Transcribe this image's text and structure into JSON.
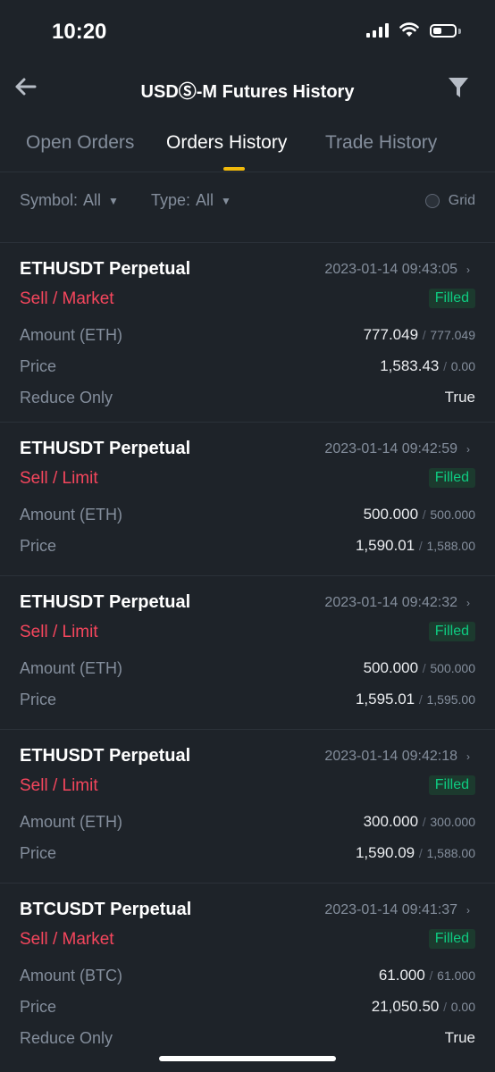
{
  "status_bar": {
    "time": "10:20"
  },
  "header": {
    "title": "USDⓈ-M Futures History"
  },
  "tabs": [
    {
      "label": "Open Orders",
      "active": false
    },
    {
      "label": "Orders History",
      "active": true
    },
    {
      "label": "Trade History",
      "active": false
    }
  ],
  "filters": {
    "symbol_label": "Symbol:",
    "symbol_value": "All",
    "type_label": "Type:",
    "type_value": "All",
    "grid_label": "Grid"
  },
  "colors": {
    "background": "#1e2329",
    "sell": "#f6465d",
    "filled": "#0ecb81",
    "accent": "#f0b90b"
  },
  "orders": [
    {
      "symbol": "ETHUSDT Perpetual",
      "timestamp": "2023-01-14 09:43:05",
      "side": "Sell / Market",
      "status": "Filled",
      "rows": [
        {
          "label": "Amount (ETH)",
          "value": "777.049",
          "sub": "777.049"
        },
        {
          "label": "Price",
          "value": "1,583.43",
          "sub": "0.00"
        },
        {
          "label": "Reduce Only",
          "value": "True",
          "sub": ""
        }
      ]
    },
    {
      "symbol": "ETHUSDT Perpetual",
      "timestamp": "2023-01-14 09:42:59",
      "side": "Sell / Limit",
      "status": "Filled",
      "rows": [
        {
          "label": "Amount (ETH)",
          "value": "500.000",
          "sub": "500.000"
        },
        {
          "label": "Price",
          "value": "1,590.01",
          "sub": "1,588.00"
        }
      ]
    },
    {
      "symbol": "ETHUSDT Perpetual",
      "timestamp": "2023-01-14 09:42:32",
      "side": "Sell / Limit",
      "status": "Filled",
      "rows": [
        {
          "label": "Amount (ETH)",
          "value": "500.000",
          "sub": "500.000"
        },
        {
          "label": "Price",
          "value": "1,595.01",
          "sub": "1,595.00"
        }
      ]
    },
    {
      "symbol": "ETHUSDT Perpetual",
      "timestamp": "2023-01-14 09:42:18",
      "side": "Sell / Limit",
      "status": "Filled",
      "rows": [
        {
          "label": "Amount (ETH)",
          "value": "300.000",
          "sub": "300.000"
        },
        {
          "label": "Price",
          "value": "1,590.09",
          "sub": "1,588.00"
        }
      ]
    },
    {
      "symbol": "BTCUSDT Perpetual",
      "timestamp": "2023-01-14 09:41:37",
      "side": "Sell / Market",
      "status": "Filled",
      "rows": [
        {
          "label": "Amount (BTC)",
          "value": "61.000",
          "sub": "61.000"
        },
        {
          "label": "Price",
          "value": "21,050.50",
          "sub": "0.00"
        },
        {
          "label": "Reduce Only",
          "value": "True",
          "sub": ""
        }
      ]
    }
  ]
}
